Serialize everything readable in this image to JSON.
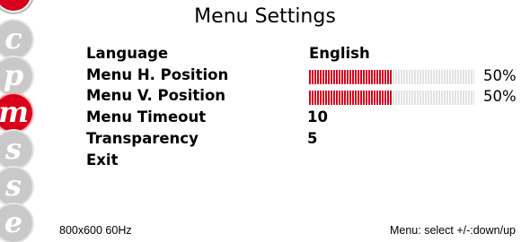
{
  "rail": {
    "buttons": [
      {
        "letter": "c",
        "active": false
      },
      {
        "letter": "p",
        "active": false
      },
      {
        "letter": "m",
        "active": true
      },
      {
        "letter": "s",
        "active": false
      },
      {
        "letter": "s",
        "active": false
      },
      {
        "letter": "e",
        "active": false
      }
    ]
  },
  "menu": {
    "title": "Menu Settings",
    "items": [
      {
        "label": "Language",
        "value": "English"
      },
      {
        "label": "Menu H. Position",
        "level": 0.5,
        "percent_text": "50%"
      },
      {
        "label": "Menu V. Position",
        "level": 0.5,
        "percent_text": "50%"
      },
      {
        "label": "Menu Timeout",
        "value": "10"
      },
      {
        "label": "Transparency",
        "value": "5"
      },
      {
        "label": "Exit"
      }
    ]
  },
  "footer": {
    "resolution": "800x600 60Hz",
    "hint": "Menu: select +/-:down/up"
  },
  "colors": {
    "accent": "#d9001b",
    "inactive_button": "#c9c9c9"
  }
}
